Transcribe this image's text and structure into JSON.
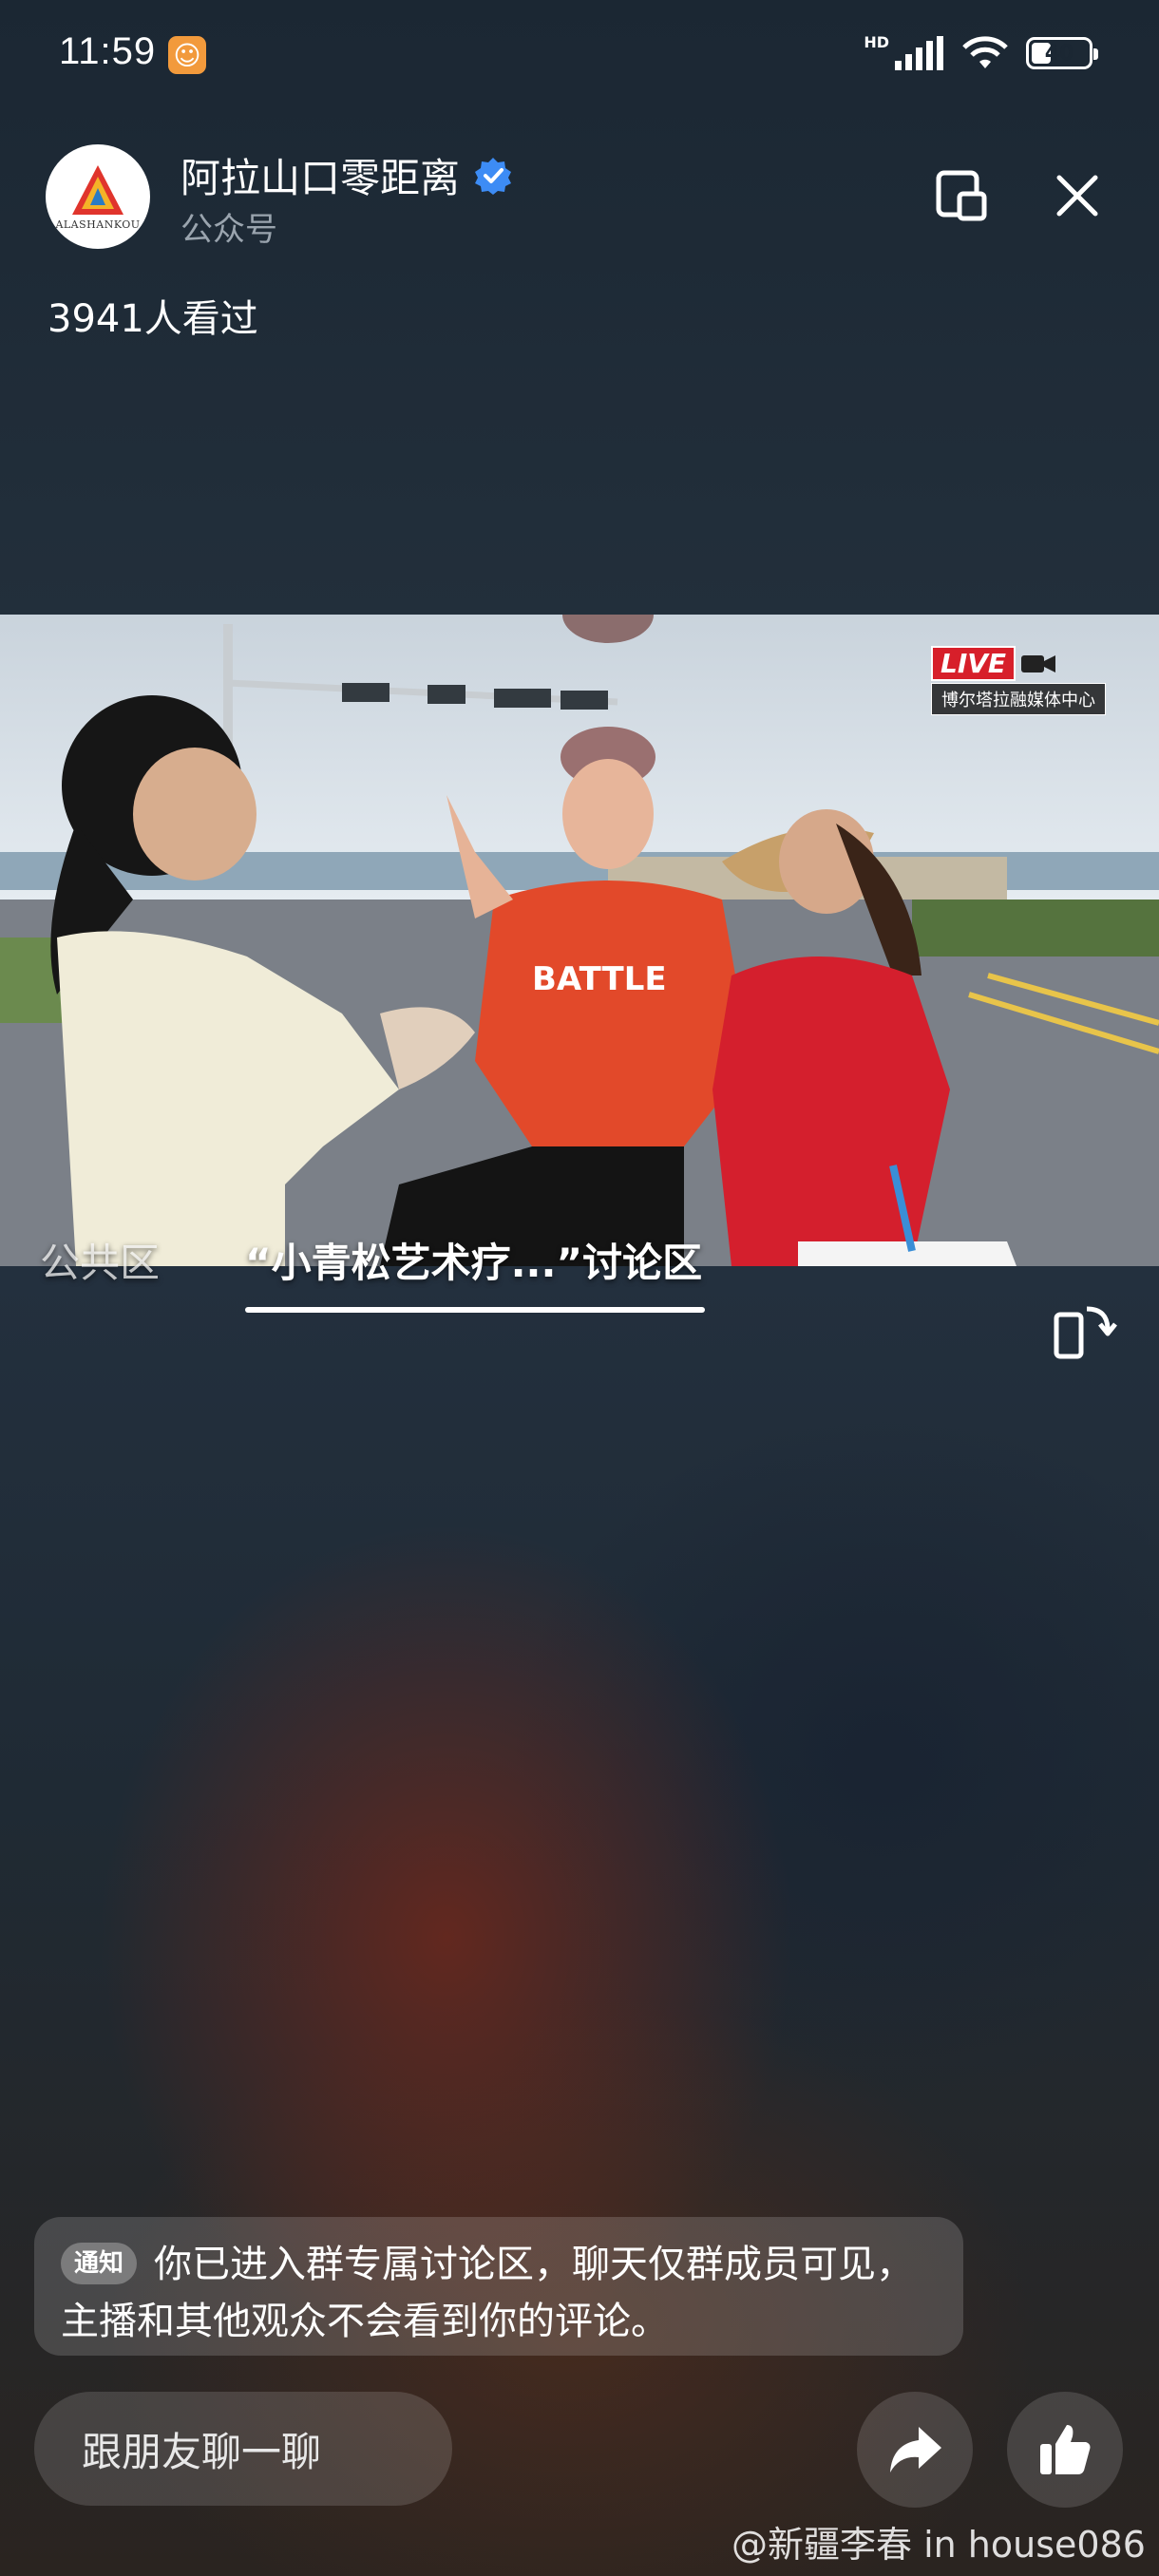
{
  "status_bar": {
    "time": "11:59",
    "app_icon": "smile-app-icon",
    "network_label": "HD",
    "battery": "40",
    "battery_level": 0.4
  },
  "header": {
    "account_name": "阿拉山口零距离",
    "account_type": "公众号",
    "avatar_text": "ALASHANKOU",
    "viewers": "3941人看过"
  },
  "video": {
    "live_label": "LIVE",
    "live_sub": "博尔塔拉融媒体中心",
    "jersey_text": "BATTLE"
  },
  "tabs": [
    {
      "label": "公共区"
    },
    {
      "label": "“小青松艺术疗...”讨论区",
      "active": true
    }
  ],
  "notice": {
    "badge": "通知",
    "text": "你已进入群专属讨论区，聊天仅群成员可见，主播和其他观众不会看到你的评论。"
  },
  "bottom": {
    "chat_label": "跟朋友聊一聊",
    "watermark": "@新疆李春 in house086"
  },
  "colors": {
    "accent_verified": "#3d8cf5",
    "live_red": "#d71f2a",
    "app_icon_orange": "#f29a3c"
  }
}
